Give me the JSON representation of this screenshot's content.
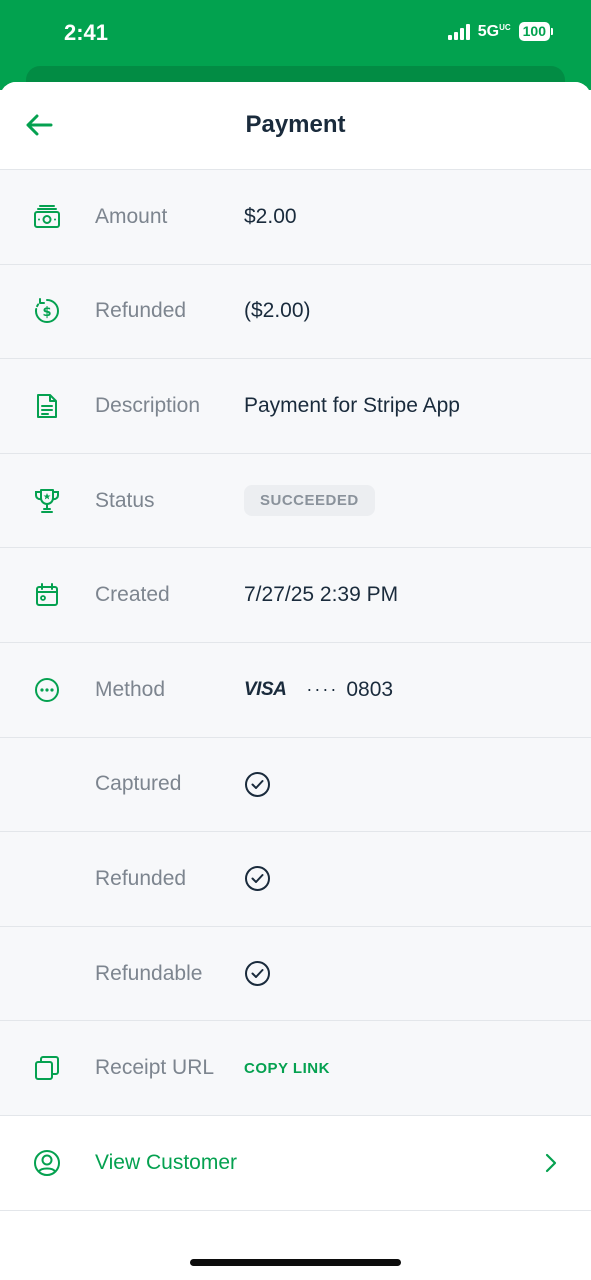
{
  "status_bar": {
    "time": "2:41",
    "network": "5G",
    "network_suffix": "UC",
    "battery": "100"
  },
  "header": {
    "title": "Payment"
  },
  "rows": [
    {
      "label": "Amount",
      "value": "$2.00",
      "icon": "money-icon"
    },
    {
      "label": "Refunded",
      "value": "($2.00)",
      "icon": "refund-icon"
    },
    {
      "label": "Description",
      "value": "Payment for Stripe App",
      "icon": "document-icon"
    },
    {
      "label": "Status",
      "value": "SUCCEEDED",
      "icon": "trophy-icon"
    },
    {
      "label": "Created",
      "value": "7/27/25 2:39 PM",
      "icon": "calendar-icon"
    },
    {
      "label": "Method",
      "card_brand": "VISA",
      "card_mask": "····",
      "card_last4": "0803",
      "icon": "more-icon"
    },
    {
      "label": "Captured",
      "icon": "check-circle-icon"
    },
    {
      "label": "Refunded",
      "icon": "check-circle-icon"
    },
    {
      "label": "Refundable",
      "icon": "check-circle-icon"
    },
    {
      "label": "Receipt URL",
      "value": "COPY LINK",
      "icon": "copy-icon"
    }
  ],
  "customer_link": {
    "label": "View Customer",
    "icon": "user-circle-icon"
  },
  "colors": {
    "brand_green": "#02a24f",
    "accent_green": "#05a150",
    "text_dark": "#1a2b3c",
    "text_muted": "#7d858f"
  }
}
